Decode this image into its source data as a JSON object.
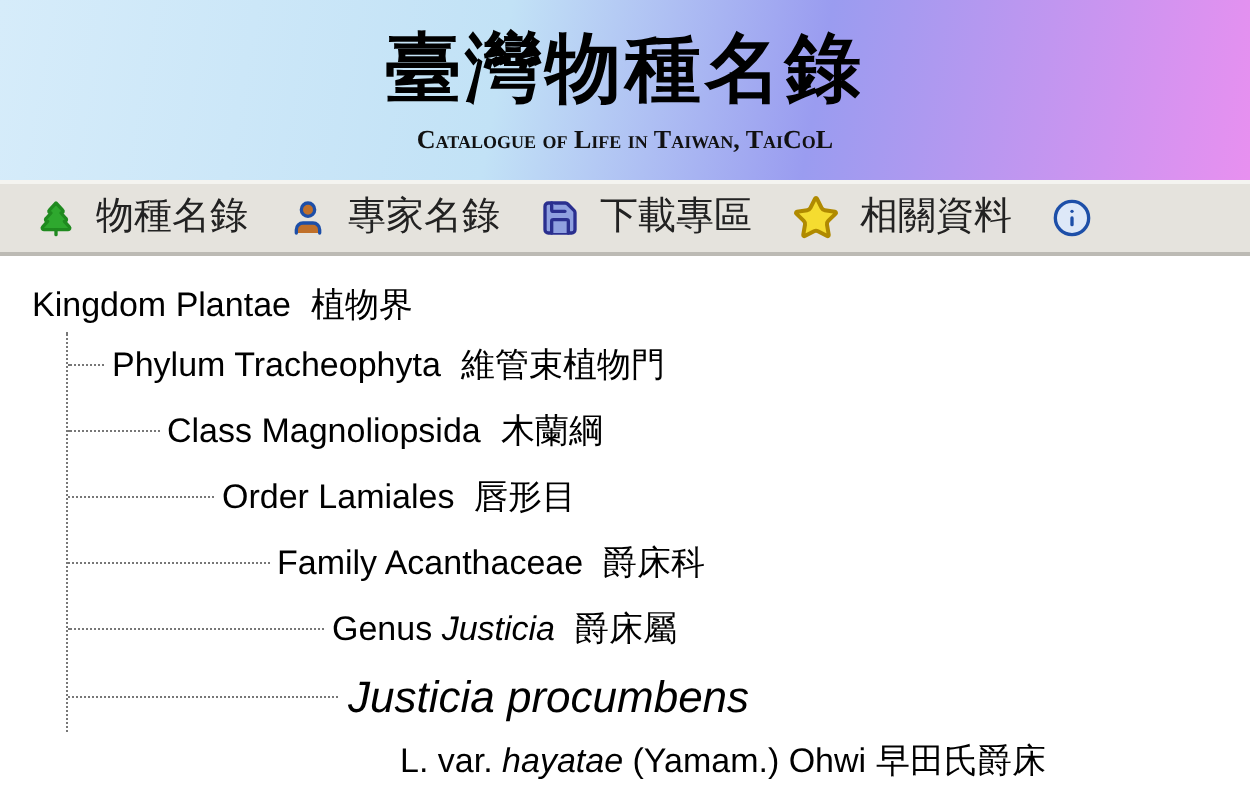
{
  "header": {
    "title": "臺灣物種名錄",
    "subtitle": "Catalogue of Life in Taiwan, TaiCoL"
  },
  "menu": [
    {
      "kind": "tree",
      "label": "物種名錄"
    },
    {
      "kind": "person",
      "label": "專家名錄"
    },
    {
      "kind": "disk",
      "label": "下載專區"
    },
    {
      "kind": "star",
      "label": "相關資料"
    },
    {
      "kind": "info"
    }
  ],
  "taxonomy": {
    "kind": "rank",
    "name": "Kingdom Plantae",
    "chinese": "植物界",
    "children": [
      {
        "kind": "rank",
        "name": "Phylum Tracheophyta",
        "chinese": "維管束植物門",
        "children": [
          {
            "kind": "rank",
            "name": "Class Magnoliopsida",
            "chinese": "木蘭綱",
            "children": [
              {
                "kind": "rank",
                "name": "Order Lamiales",
                "chinese": "唇形目",
                "children": [
                  {
                    "kind": "rank",
                    "name": "Family Acanthaceae",
                    "chinese": "爵床科",
                    "children": [
                      {
                        "kind": "rank",
                        "name": "Genus *Justicia*",
                        "chinese": "爵床屬",
                        "children": [
                          {
                            "kind": "species",
                            "name": "Justicia procumbens",
                            "authority": "L. var. *hayatae* (Yamam.) Ohwi",
                            "chinese": "早田氏爵床"
                          }
                        ]
                      }
                    ]
                  }
                ]
              }
            ]
          }
        ]
      }
    ]
  }
}
